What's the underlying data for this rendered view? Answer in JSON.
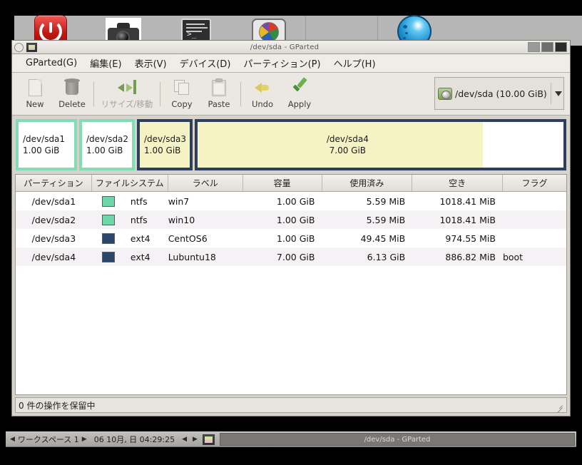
{
  "desktop": {
    "launcher_icons": [
      {
        "name": "power-icon",
        "label": "Shutdown"
      },
      {
        "name": "camera-icon",
        "label": "Screenshot"
      },
      {
        "name": "terminal-icon",
        "label": "Terminal"
      },
      {
        "name": "disk-icon",
        "label": "Partition Editor"
      },
      {
        "name": "globe-icon",
        "label": "Web Browser"
      }
    ]
  },
  "window": {
    "title": "/dev/sda - GParted",
    "controls": {
      "minimize": "_",
      "maximize": "□",
      "close": "×"
    }
  },
  "menubar": {
    "items": [
      {
        "label": "GParted(G)",
        "mnemonic": "G"
      },
      {
        "label": "編集(E)",
        "mnemonic": "E"
      },
      {
        "label": "表示(V)",
        "mnemonic": "V"
      },
      {
        "label": "デバイス(D)",
        "mnemonic": "D"
      },
      {
        "label": "パーティション(P)",
        "mnemonic": "P"
      },
      {
        "label": "ヘルプ(H)",
        "mnemonic": "H"
      }
    ]
  },
  "toolbar": {
    "new_label": "New",
    "delete_label": "Delete",
    "resize_label": "リサイズ/移動",
    "copy_label": "Copy",
    "paste_label": "Paste",
    "undo_label": "Undo",
    "apply_label": "Apply"
  },
  "device_selector": {
    "label": "/dev/sda  (10.00 GiB)",
    "device": "/dev/sda",
    "size": "10.00 GiB"
  },
  "partition_graphic": [
    {
      "name": "/dev/sda1",
      "size": "1.00 GiB",
      "style": "ntfs",
      "selected": false
    },
    {
      "name": "/dev/sda2",
      "size": "1.00 GiB",
      "style": "ntfs",
      "selected": false
    },
    {
      "name": "/dev/sda3",
      "size": "1.00 GiB",
      "style": "ext4",
      "selected": true
    },
    {
      "name": "/dev/sda4",
      "size": "7.00 GiB",
      "style": "ext4",
      "selected": false
    }
  ],
  "table": {
    "headers": [
      "パーティション",
      "ファイルシステム",
      "ラベル",
      "容量",
      "使用済み",
      "空き",
      "フラグ"
    ],
    "rows": [
      {
        "partition": "/dev/sda1",
        "filesystem": "ntfs",
        "fs_color": "#6ed6a9",
        "label": "win7",
        "capacity": "1.00 GiB",
        "used": "5.59 MiB",
        "unused": "1018.41 MiB",
        "flags": ""
      },
      {
        "partition": "/dev/sda2",
        "filesystem": "ntfs",
        "fs_color": "#6ed6a9",
        "label": "win10",
        "capacity": "1.00 GiB",
        "used": "5.59 MiB",
        "unused": "1018.41 MiB",
        "flags": ""
      },
      {
        "partition": "/dev/sda3",
        "filesystem": "ext4",
        "fs_color": "#2b4668",
        "label": "CentOS6",
        "capacity": "1.00 GiB",
        "used": "49.45 MiB",
        "unused": "974.55 MiB",
        "flags": ""
      },
      {
        "partition": "/dev/sda4",
        "filesystem": "ext4",
        "fs_color": "#2b4668",
        "label": "Lubuntu18",
        "capacity": "7.00 GiB",
        "used": "6.13 GiB",
        "unused": "886.82 MiB",
        "flags": "boot"
      }
    ]
  },
  "statusbar": {
    "text": "0 件の操作を保留中"
  },
  "taskbar": {
    "prev_arrow": "◀",
    "next_arrow": "▶",
    "workspace": "ワークスペース 1",
    "clock": "06 10月, 日 04:29:25",
    "clock_prev": "◀",
    "clock_next": "▶",
    "task_button": "/dev/sda - GParted"
  },
  "colors": {
    "ntfs": "#6ed6a9",
    "ext4": "#2b4668",
    "ext4_fill": "#f5f3c4",
    "selection_border": "#2e3e5c",
    "window_bg": "#d6d3cc"
  }
}
